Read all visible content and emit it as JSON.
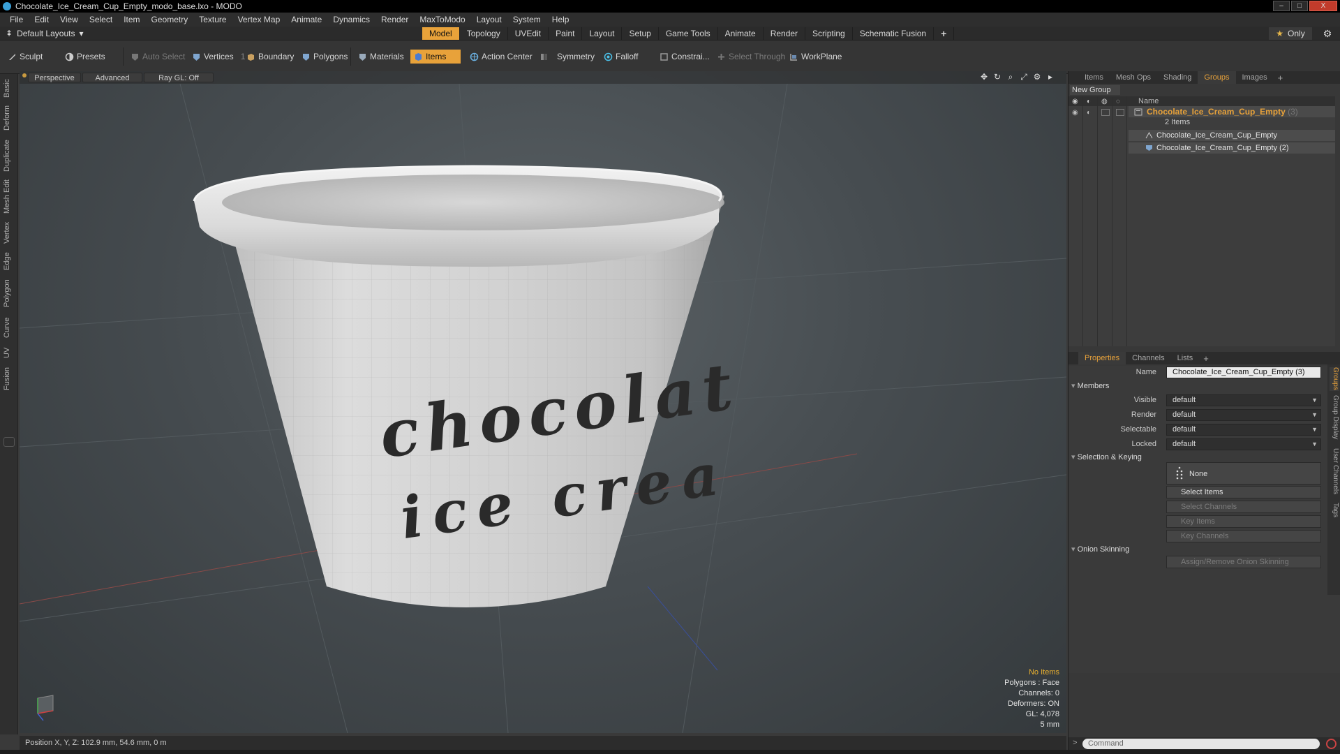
{
  "window": {
    "title": "Chocolate_Ice_Cream_Cup_Empty_modo_base.lxo - MODO",
    "controls": [
      "–",
      "□",
      "X"
    ]
  },
  "menubar": [
    "File",
    "Edit",
    "View",
    "Select",
    "Item",
    "Geometry",
    "Texture",
    "Vertex Map",
    "Animate",
    "Dynamics",
    "Render",
    "MaxToModo",
    "Layout",
    "System",
    "Help"
  ],
  "layoutbar": {
    "layout_select": "Default Layouts",
    "tabs": [
      "Model",
      "Topology",
      "UVEdit",
      "Paint",
      "Layout",
      "Setup",
      "Game Tools",
      "Animate",
      "Render",
      "Scripting",
      "Schematic Fusion"
    ],
    "active_tab": "Model",
    "only_label": "Only"
  },
  "toolbar": {
    "sculpt": "Sculpt",
    "presets": "Presets",
    "auto_select": "Auto Select",
    "vertices": "Vertices",
    "vertices_count": "1",
    "boundary": "Boundary",
    "polygons": "Polygons",
    "materials": "Materials",
    "items": "Items",
    "action_center": "Action Center",
    "symmetry": "Symmetry",
    "falloff": "Falloff",
    "constraints": "Constrai...",
    "select_through": "Select Through",
    "workplane": "WorkPlane"
  },
  "left_tabs": [
    "Basic",
    "Deform",
    "Duplicate",
    "Mesh Edit",
    "Vertex",
    "Edge",
    "Polygon",
    "Curve",
    "UV",
    "Fusion"
  ],
  "viewport": {
    "view": "Perspective",
    "shading": "Advanced",
    "raygl": "Ray GL: Off",
    "cup_text_line1": "chocolat",
    "cup_text_line2": "ice crea",
    "info": {
      "no_items": "No Items",
      "polygons": "Polygons : Face",
      "channels": "Channels: 0",
      "deformers": "Deformers: ON",
      "gl": "GL: 4,078",
      "scale": "5 mm"
    }
  },
  "statusbar": {
    "position": "Position X, Y, Z:  102.9 mm, 54.6 mm, 0 m"
  },
  "groups_panel": {
    "tabs": [
      "Items",
      "Mesh Ops",
      "Shading",
      "Groups",
      "Images"
    ],
    "active_tab": "Groups",
    "new_group": "New Group",
    "name_header": "Name",
    "group_name": "Chocolate_Ice_Cream_Cup_Empty",
    "group_count": "(3)",
    "sub_count": "2 Items",
    "items": [
      "Chocolate_Ice_Cream_Cup_Empty",
      "Chocolate_Ice_Cream_Cup_Empty (2)"
    ]
  },
  "properties_panel": {
    "tabs": [
      "Properties",
      "Channels",
      "Lists"
    ],
    "active_tab": "Properties",
    "name_label": "Name",
    "name_value": "Chocolate_Ice_Cream_Cup_Empty (3)",
    "members_section": "Members",
    "visible_label": "Visible",
    "visible_value": "default",
    "render_label": "Render",
    "render_value": "default",
    "selectable_label": "Selectable",
    "selectable_value": "default",
    "locked_label": "Locked",
    "locked_value": "default",
    "selection_section": "Selection & Keying",
    "none_label": "None",
    "select_items": "Select Items",
    "select_channels": "Select Channels",
    "key_items": "Key Items",
    "key_channels": "Key Channels",
    "onion_section": "Onion Skinning",
    "onion_button": "Assign/Remove Onion Skinning",
    "side_tabs": [
      "Groups",
      "Group Display",
      "User Channels",
      "Tags"
    ]
  },
  "command": {
    "placeholder": "Command"
  },
  "colors": {
    "accent": "#e8a23a",
    "titlebar": "#000000",
    "close": "#c23b2b"
  }
}
